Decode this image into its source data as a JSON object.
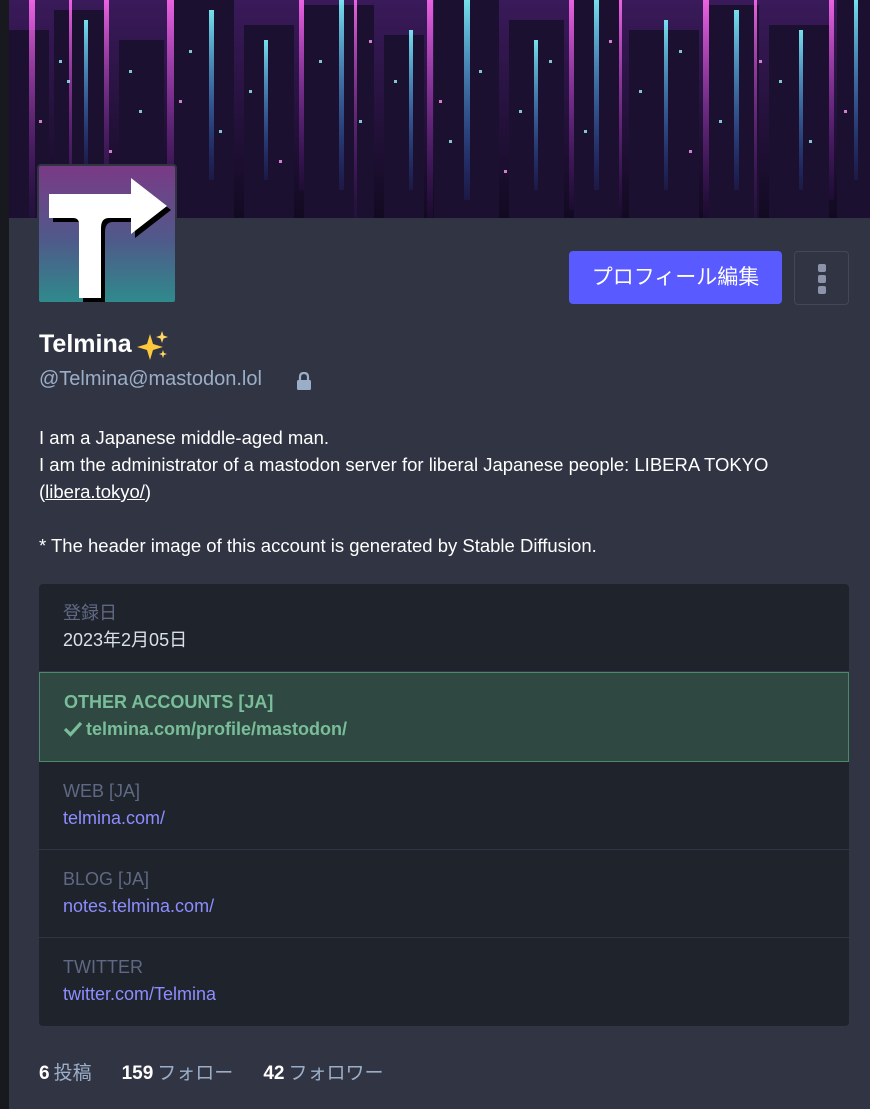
{
  "profile": {
    "display_name": "Telmina",
    "display_name_emoji": "sparkles-emoji",
    "handle": "@Telmina@mastodon.lol",
    "locked": true,
    "edit_profile_label": "プロフィール編集",
    "avatar_icon": "arrow-t-logo",
    "bio": {
      "line1": "I am a Japanese middle-aged man.",
      "line2_prefix": "I am the administrator of a mastodon server for liberal Japanese people: LIBERA TOKYO (",
      "line2_link": "libera.tokyo/",
      "line2_suffix": ")",
      "line3": "* The header image of this account is generated by Stable Diffusion."
    }
  },
  "fields": {
    "joined_label": "登録日",
    "joined_value": "2023年2月05日",
    "other_label": "OTHER ACCOUNTS [JA]",
    "other_value": "telmina.com/profile/mastodon/",
    "web_label": "WEB [JA]",
    "web_value": "telmina.com/",
    "blog_label": "BLOG [JA]",
    "blog_value": "notes.telmina.com/",
    "twitter_label": "TWITTER",
    "twitter_value": "twitter.com/Telmina"
  },
  "stats": {
    "posts_count": "6",
    "posts_label": "投稿",
    "following_count": "159",
    "following_label": "フォロー",
    "followers_count": "42",
    "followers_label": "フォロワー"
  },
  "colors": {
    "accent": "#595aff",
    "verified": "#79bd9a",
    "link": "#8c8dff"
  }
}
